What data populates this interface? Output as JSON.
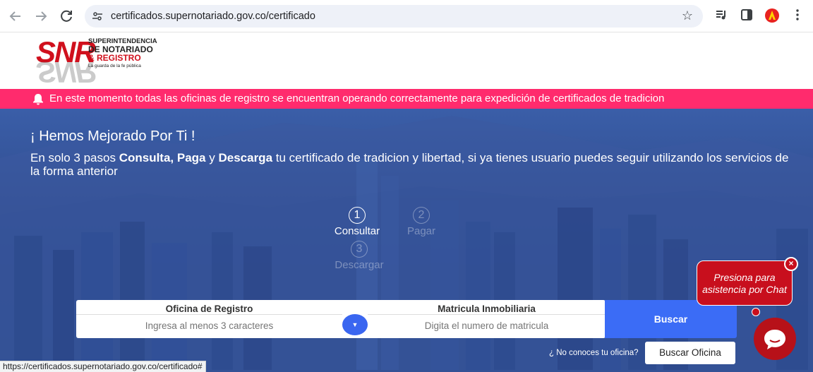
{
  "browser": {
    "url": "certificados.supernotariado.gov.co/certificado",
    "back_icon": "back-arrow-icon",
    "forward_icon": "forward-arrow-icon",
    "reload_icon": "reload-icon"
  },
  "logo": {
    "mark": "SNR",
    "line1": "SUPERINTENDENCIA",
    "line2": "DE NOTARIADO",
    "line3": "& REGISTRO",
    "tagline": "La guarda de la fe pública"
  },
  "alert": {
    "text": "En este momento todas las oficinas de registro se encuentran operando correctamente para expedición de certificados de tradicion"
  },
  "hero": {
    "title": "¡ Hemos Mejorado Por Ti !",
    "text_pre": "En solo 3 pasos ",
    "bold1": "Consulta, Paga",
    "text_mid1": " y ",
    "bold2": "Descarga",
    "text_post": " tu certificado de tradicion y libertad, si ya tienes usuario puedes seguir utilizando los servicios de la forma anterior"
  },
  "steps": [
    {
      "num": "1",
      "label": "Consultar"
    },
    {
      "num": "2",
      "label": "Pagar"
    },
    {
      "num": "3",
      "label": "Descargar"
    }
  ],
  "form": {
    "oficina_label": "Oficina de Registro",
    "oficina_placeholder": "Ingresa al menos 3 caracteres",
    "matricula_label": "Matricula Inmobiliaria",
    "matricula_placeholder": "Digita el numero de matricula",
    "buscar": "Buscar",
    "no_conoces": "¿ No conoces tu oficina?",
    "buscar_oficina": "Buscar Oficina"
  },
  "chat": {
    "bubble": "Presiona para asistencia por Chat",
    "close": "×"
  },
  "statusbar": {
    "text": "https://certificados.supernotariado.gov.co/certificado#"
  },
  "colors": {
    "alert_bg": "#ff2b6d",
    "primary_blue": "#3b6cf6",
    "brand_red": "#c80f1d"
  }
}
